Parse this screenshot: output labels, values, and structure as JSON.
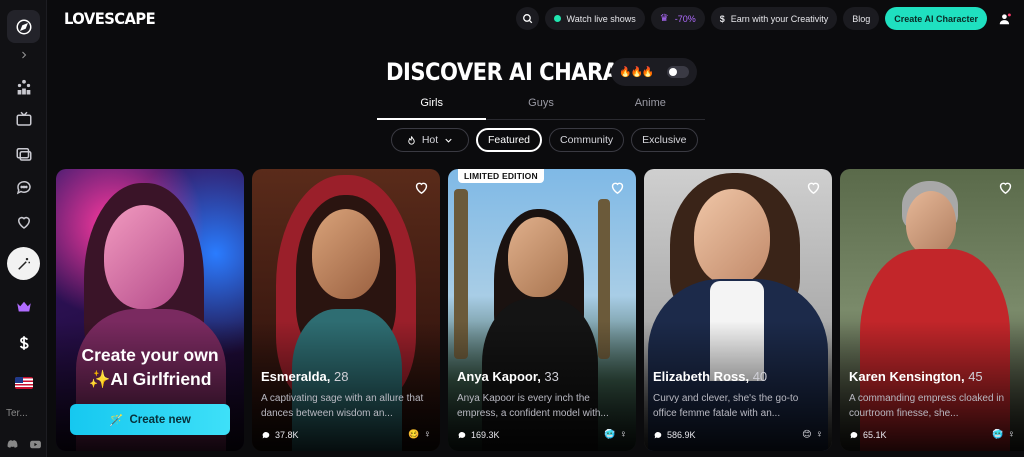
{
  "app": {
    "logo": "LOVESCAPE"
  },
  "header": {
    "watch_live": "Watch live shows",
    "discount": "-70%",
    "earn": "Earn with your Creativity",
    "blog": "Blog",
    "create_cta": "Create AI Character"
  },
  "sidebar": {
    "language": "Ter..."
  },
  "page": {
    "title": "DISCOVER AI CHARACTERS"
  },
  "tabs": [
    {
      "label": "Girls",
      "active": true
    },
    {
      "label": "Guys",
      "active": false
    },
    {
      "label": "Anime",
      "active": false
    }
  ],
  "filters": {
    "sort": "Hot",
    "items": [
      {
        "label": "Featured",
        "active": true
      },
      {
        "label": "Community",
        "active": false
      },
      {
        "label": "Exclusive",
        "active": false
      }
    ]
  },
  "create_card": {
    "title_line1": "Create your own",
    "title_line2": "✨AI Girlfriend",
    "button": "Create new"
  },
  "characters": [
    {
      "name": "Esmeralda",
      "age": "28",
      "description": "A captivating sage with an allure that dances between wisdom an...",
      "chats": "37.8K",
      "emoji": "🥴",
      "gender": "♀",
      "badge": ""
    },
    {
      "name": "Anya Kapoor",
      "age": "33",
      "description": "Anya Kapoor is every inch the empress, a confident model with...",
      "chats": "169.3K",
      "emoji": "🥶",
      "gender": "♀",
      "badge": "LIMITED EDITION"
    },
    {
      "name": "Elizabeth Ross",
      "age": "40",
      "description": "Curvy and clever, she's the go-to office femme fatale with an...",
      "chats": "586.9K",
      "emoji": "😊",
      "gender": "♀",
      "badge": ""
    },
    {
      "name": "Karen Kensington",
      "age": "45",
      "description": "A commanding empress cloaked in courtroom finesse, she...",
      "chats": "65.1K",
      "emoji": "🥶",
      "gender": "♀",
      "badge": ""
    }
  ]
}
